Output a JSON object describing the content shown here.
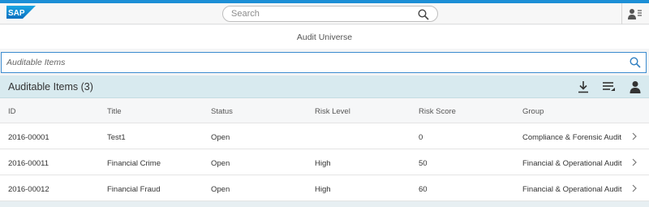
{
  "shell": {
    "logo_text": "SAP",
    "search_placeholder": "Search"
  },
  "page": {
    "title": "Audit Universe"
  },
  "filter": {
    "placeholder": "Auditable Items"
  },
  "toolbar": {
    "title": "Auditable Items (3)",
    "icons": [
      "download-icon",
      "sort-icon",
      "personalize-icon"
    ]
  },
  "table": {
    "columns": [
      "ID",
      "Title",
      "Status",
      "Risk Level",
      "Risk Score",
      "Group"
    ],
    "rows": [
      {
        "id": "2016-00001",
        "title": "Test1",
        "status": "Open",
        "risk_level": "",
        "risk_score": "0",
        "group": "Compliance & Forensic Audit"
      },
      {
        "id": "2016-00011",
        "title": "Financial Crime",
        "status": "Open",
        "risk_level": "High",
        "risk_score": "50",
        "group": "Financial & Operational Audit"
      },
      {
        "id": "2016-00012",
        "title": "Financial Fraud",
        "status": "Open",
        "risk_level": "High",
        "risk_score": "60",
        "group": "Financial & Operational Audit"
      }
    ]
  },
  "colors": {
    "accent": "#1c8fd6",
    "toolbar_bg": "#d8eaef",
    "focus_border": "#3b8bcf"
  }
}
